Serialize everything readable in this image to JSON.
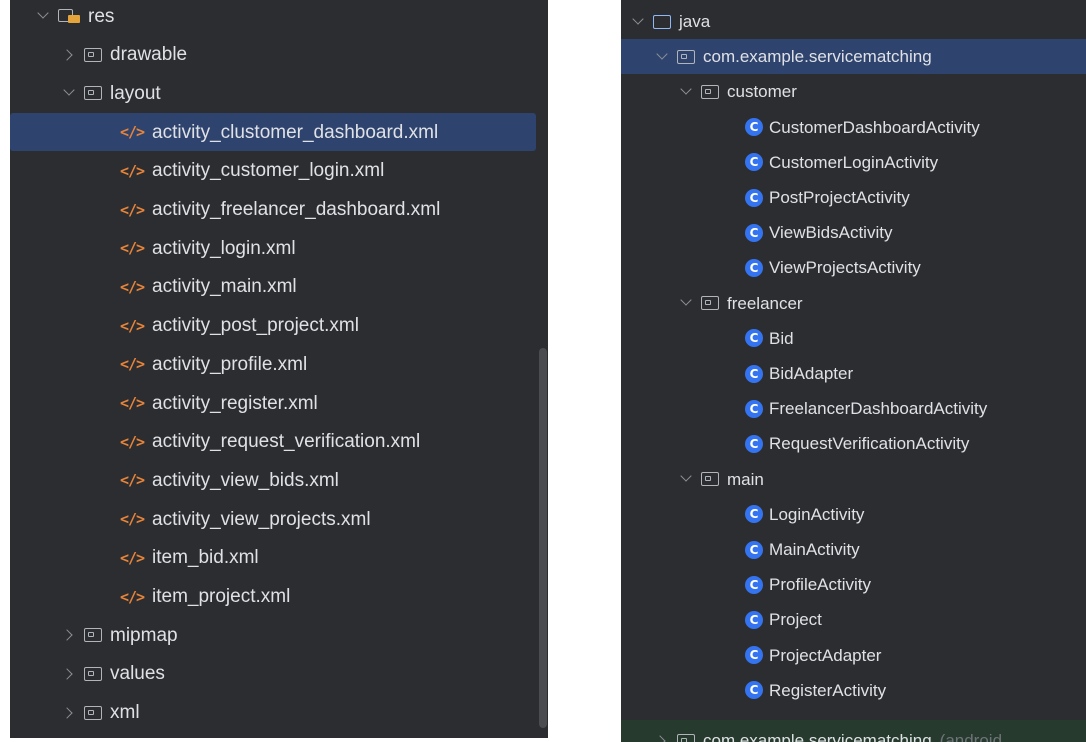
{
  "left": {
    "root": "res",
    "folders_before": [
      "drawable"
    ],
    "layout_folder": "layout",
    "files": [
      "activity_clustomer_dashboard.xml",
      "activity_customer_login.xml",
      "activity_freelancer_dashboard.xml",
      "activity_login.xml",
      "activity_main.xml",
      "activity_post_project.xml",
      "activity_profile.xml",
      "activity_register.xml",
      "activity_request_verification.xml",
      "activity_view_bids.xml",
      "activity_view_projects.xml",
      "item_bid.xml",
      "item_project.xml"
    ],
    "selected_file": "activity_clustomer_dashboard.xml",
    "folders_after": [
      "mipmap",
      "values",
      "xml"
    ],
    "xml_glyph": "</>"
  },
  "right": {
    "root": "java",
    "package": "com.example.servicematching",
    "groups": [
      {
        "name": "customer",
        "classes": [
          "CustomerDashboardActivity",
          "CustomerLoginActivity",
          "PostProjectActivity",
          "ViewBidsActivity",
          "ViewProjectsActivity"
        ]
      },
      {
        "name": "freelancer",
        "classes": [
          "Bid",
          "BidAdapter",
          "FreelancerDashboardActivity",
          "RequestVerificationActivity"
        ]
      },
      {
        "name": "main",
        "classes": [
          "LoginActivity",
          "MainActivity",
          "ProfileActivity",
          "Project",
          "ProjectAdapter",
          "RegisterActivity"
        ]
      }
    ],
    "partial_package": "com.example.servicematching",
    "partial_suffix": "(android"
  },
  "class_glyph": "C",
  "colors": {
    "panel_bg": "#2b2d30",
    "selection": "#2e436e",
    "text": "#dfe1e5",
    "class_icon": "#3574f0",
    "xml_icon": "#e8843a"
  }
}
